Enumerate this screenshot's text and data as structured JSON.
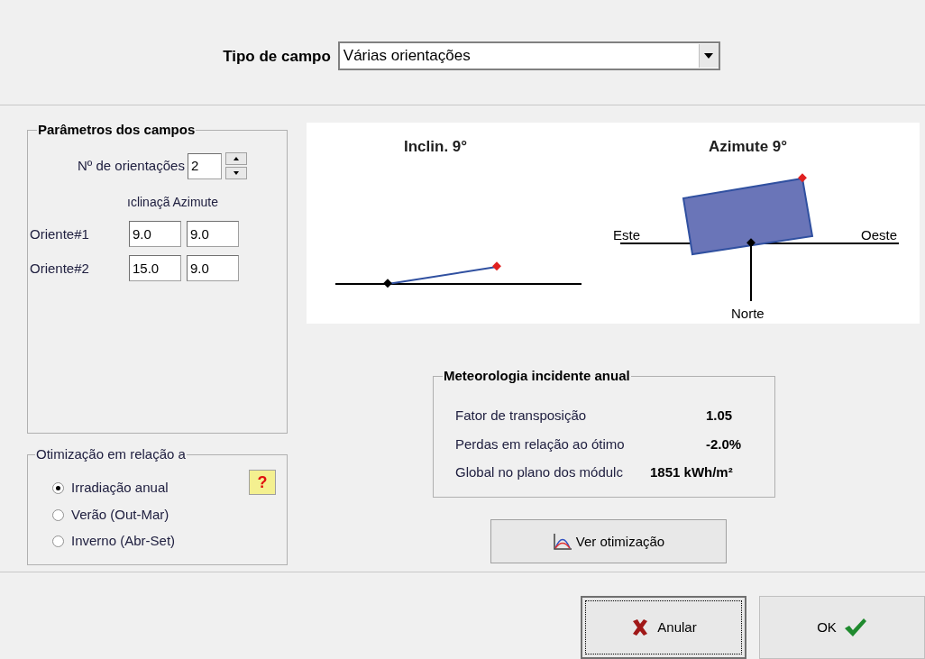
{
  "field_type": {
    "label": "Tipo de campo",
    "value": "Várias orientações"
  },
  "parameters": {
    "title": "Parâmetros dos campos",
    "count_label": "Nº de orientações",
    "count": "2",
    "columns": [
      "ıclinaçã",
      "Azimute"
    ],
    "rows": [
      {
        "label": "Oriente#1",
        "values": [
          "9.0",
          "9.0"
        ]
      },
      {
        "label": "Oriente#2",
        "values": [
          "15.0",
          "9.0"
        ]
      }
    ]
  },
  "optimization": {
    "title": "Otimização em relação a",
    "help": "?",
    "options": [
      {
        "label": "Irradiação anual",
        "selected": true
      },
      {
        "label": "Verão (Out-Mar)",
        "selected": false
      },
      {
        "label": "Inverno (Abr-Set)",
        "selected": false
      }
    ]
  },
  "diagram": {
    "tilt_title": "Inclin. 9°",
    "azimuth_title": "Azimute 9°",
    "east": "Este",
    "west": "Oeste",
    "north": "Norte"
  },
  "meteo": {
    "title": "Meteorologia incidente anual",
    "rows": [
      {
        "label": "Fator de transposição",
        "value": "1.05"
      },
      {
        "label": "Perdas em relação ao ótimo",
        "value": "-2.0%"
      },
      {
        "label": "Global no plano dos módulc",
        "value": "1851 kWh/m²"
      }
    ]
  },
  "view_button": "Ver otimização",
  "buttons": [
    {
      "kind": "cancel",
      "label": "Anular",
      "focused": true
    },
    {
      "kind": "ok",
      "label": "OK",
      "focused": false
    }
  ]
}
